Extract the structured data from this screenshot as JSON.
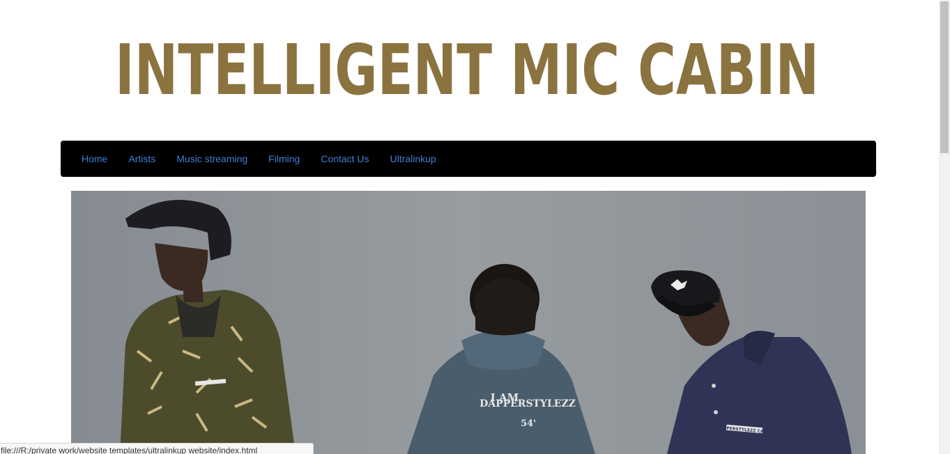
{
  "site": {
    "logo_text": "INTELLIGENT MIC CABIN",
    "logo_color": "#8b7340"
  },
  "nav": {
    "items": [
      {
        "label": "Home"
      },
      {
        "label": "Artists"
      },
      {
        "label": "Music streaming"
      },
      {
        "label": "Filming"
      },
      {
        "label": "Contact Us"
      },
      {
        "label": "Ultralinkup"
      }
    ],
    "link_color": "#3f7fd3",
    "background": "#000000"
  },
  "hero": {
    "jacket_text_1": "I AM",
    "jacket_text_2": "DAPPERSTYLEZZ",
    "jacket_text_3": "54'",
    "chest_logo": "DAPPERSTYLEZZ CABIN"
  },
  "status": {
    "url": "file:///R:/private work/website templates/ultralinkup website/index.html"
  }
}
